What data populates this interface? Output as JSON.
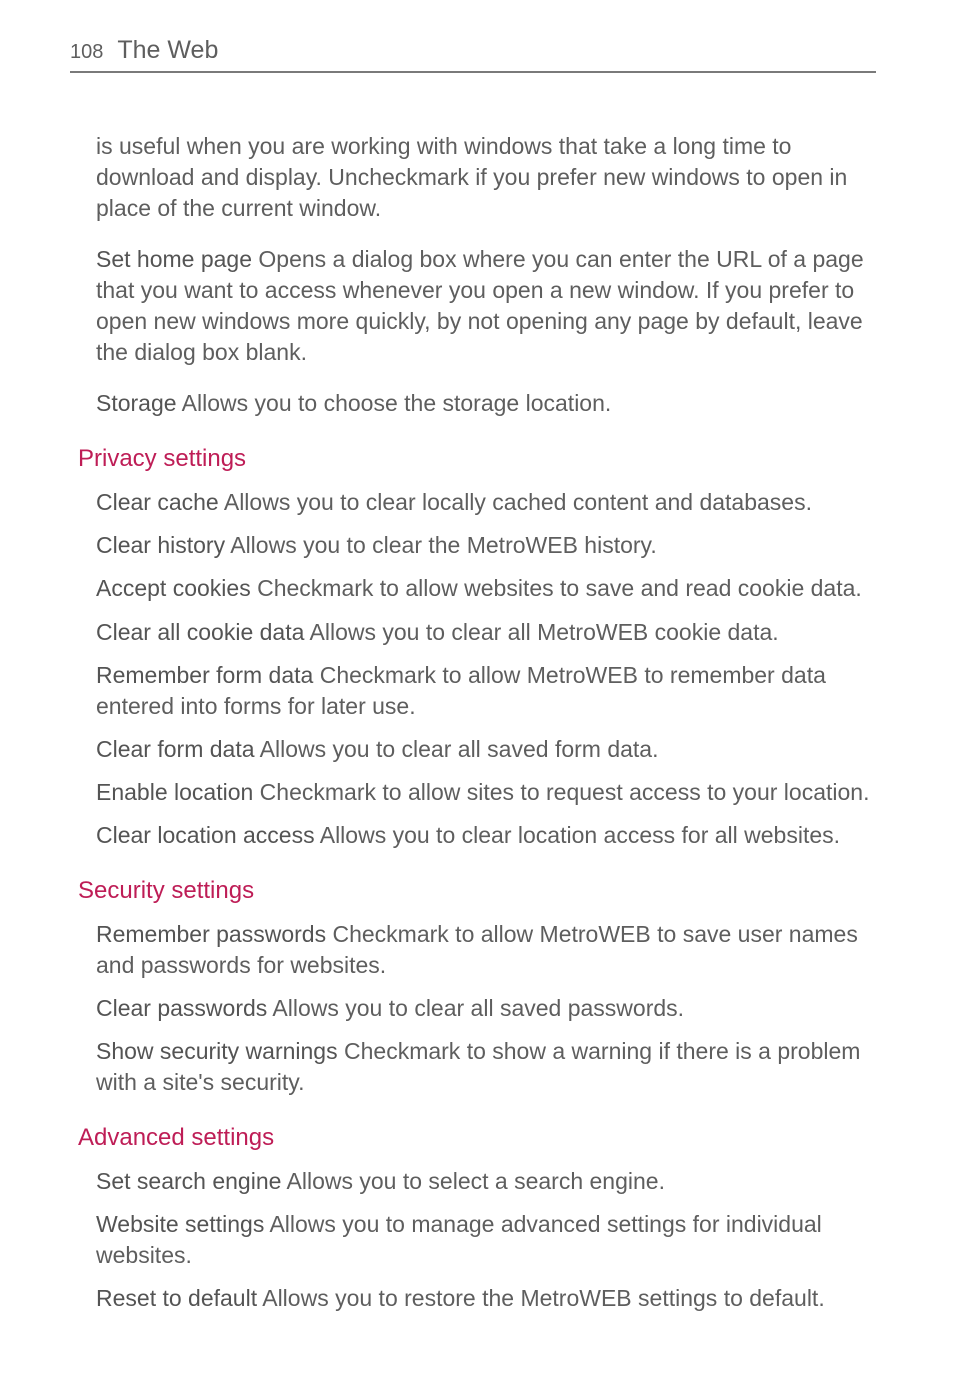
{
  "header": {
    "page_number": "108",
    "title": "The Web"
  },
  "intro": {
    "paragraph1": "is useful when you are working with windows that take a long time to download and display. Uncheckmark if you prefer new windows to open in place of the current window.",
    "set_home_label": "Set home page",
    "set_home_desc": " Opens a dialog box where you can enter the URL of a page that you want to access whenever you open a new window. If you prefer to open new windows more quickly, by not opening any page by default, leave the dialog box blank.",
    "storage_label": "Storage",
    "storage_desc": " Allows you to choose the storage location."
  },
  "sections": [
    {
      "heading": "Privacy settings",
      "items": [
        {
          "label": "Clear cache",
          "desc": " Allows you to clear locally cached content and databases."
        },
        {
          "label": "Clear history",
          "desc": " Allows you to clear the MetroWEB history."
        },
        {
          "label": "Accept cookies",
          "desc": " Checkmark to allow websites to save and read cookie data."
        },
        {
          "label": "Clear all cookie data",
          "desc": " Allows you to clear all MetroWEB cookie data."
        },
        {
          "label": "Remember form data",
          "desc": " Checkmark to allow MetroWEB to remember data entered into forms for later use."
        },
        {
          "label": "Clear form data",
          "desc": " Allows you to clear all saved form data."
        },
        {
          "label": "Enable location",
          "desc": " Checkmark to allow sites to request access to your location."
        },
        {
          "label": "Clear location access",
          "desc": " Allows you to clear location access for all websites."
        }
      ]
    },
    {
      "heading": "Security settings",
      "items": [
        {
          "label": "Remember passwords",
          "desc": " Checkmark to allow MetroWEB to save user names and passwords for websites."
        },
        {
          "label": "Clear passwords",
          "desc": " Allows you to clear all saved passwords."
        },
        {
          "label": "Show security warnings",
          "desc": " Checkmark to show a warning if there is a problem with a site's security."
        }
      ]
    },
    {
      "heading": "Advanced settings",
      "items": [
        {
          "label": "Set search engine",
          "desc": " Allows you to select a search engine."
        },
        {
          "label": "Website settings",
          "desc": " Allows you to manage advanced settings for individual websites."
        },
        {
          "label": "Reset to default",
          "desc": " Allows you to restore the MetroWEB settings to default."
        }
      ]
    }
  ]
}
